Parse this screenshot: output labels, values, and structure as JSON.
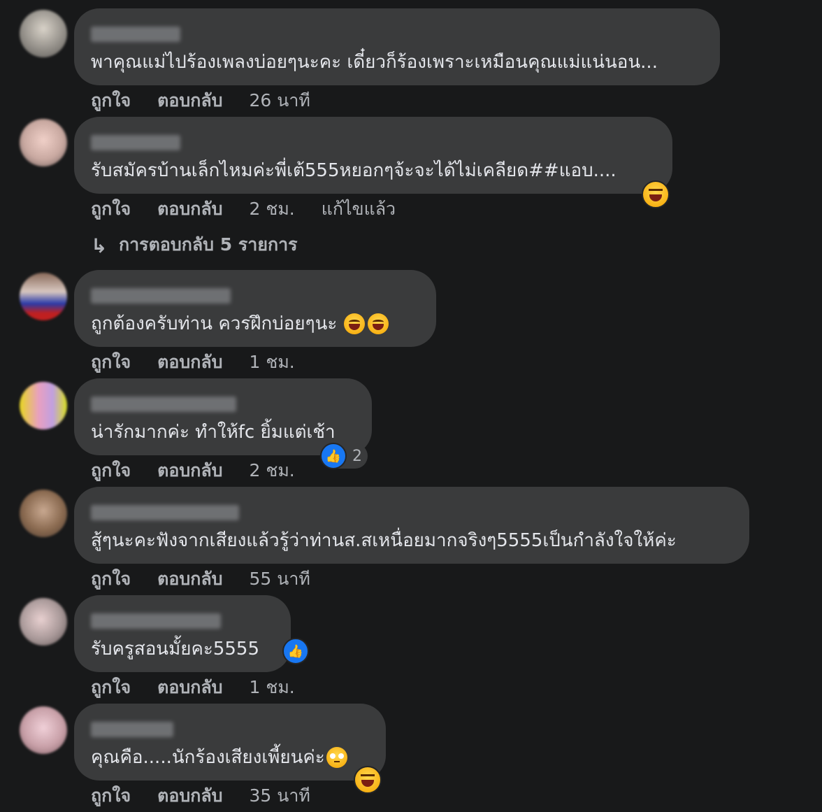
{
  "actions": {
    "like": "ถูกใจ",
    "reply": "ตอบกลับ"
  },
  "comments": [
    {
      "text": "พาคุณแม่ไปร้องเพลงบ่อยๆนะคะ เดี๋ยวก็ร้องเพราะเหมือนคุณแม่แน่นอน...",
      "time": "26 นาที"
    },
    {
      "text": "รับสมัครบ้านเล็กไหมค่ะพี่เต้555หยอกๆจ้ะจะได้ไม่เคลียด##แอบ....",
      "time": "2 ชม.",
      "edited": "แก้ไขแล้ว",
      "reaction_emoji": "laughing-squint-emoji"
    },
    {
      "text": "ถูกต้องครับท่าน ควรฝึกบ่อยๆนะ",
      "time": "1 ชม.",
      "inline_emoji": [
        "grinning-sweat-emoji",
        "grinning-sweat-emoji"
      ]
    },
    {
      "text": "น่ารักมากค่ะ ทำให้fc ยิ้มแต่เช้า",
      "time": "2 ชม.",
      "reaction_count": "2"
    },
    {
      "text": "สู้ๆนะคะฟังจากเสียงแล้วรู้ว่าท่านส.สเหนื่อยมากจริงๆ5555เป็นกำลังใจให้ค่ะ",
      "time": "55 นาที"
    },
    {
      "text": "รับครูสอนมั้ยคะ5555",
      "time": "1 ชม.",
      "reaction_icon": "like-icon"
    },
    {
      "text": "คุณคือ.....นักร้องเสียงเพี้ยนค่ะ",
      "time": "35 นาที",
      "inline_emoji": [
        "pleading-face-emoji"
      ],
      "reaction_emoji": "laughing-squint-emoji"
    }
  ],
  "replies_link": {
    "label": "การตอบกลับ 5 รายการ",
    "icon": "reply-arrow-icon"
  },
  "colors": {
    "background": "#18191a",
    "bubble": "#3a3b3c",
    "text": "#e4e6eb",
    "secondary_text": "#b0b3b8",
    "like_blue": "#1877f2"
  }
}
